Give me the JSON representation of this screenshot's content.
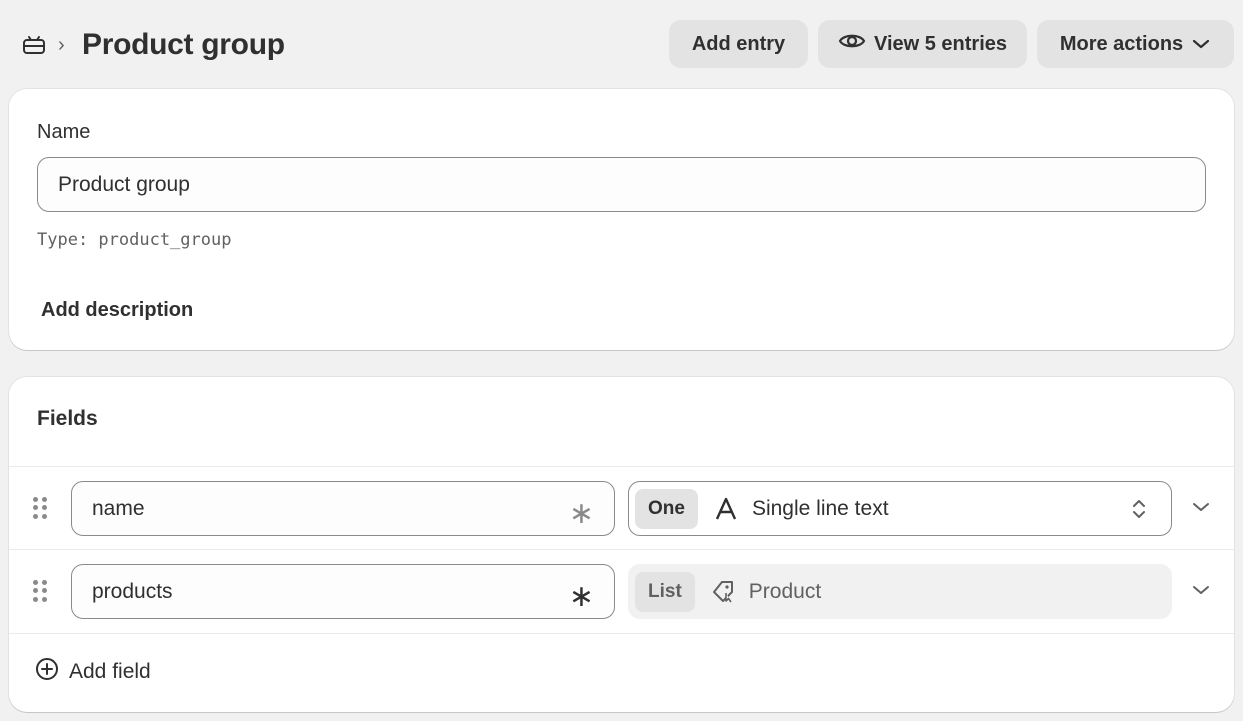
{
  "header": {
    "breadcrumb_separator": "›",
    "title": "Product group",
    "buttons": {
      "add_entry": "Add entry",
      "view_entries": "View 5 entries",
      "more_actions": "More actions"
    }
  },
  "name_card": {
    "label": "Name",
    "value": "Product group",
    "type_line": "Type: product_group",
    "add_description": "Add description"
  },
  "fields_card": {
    "title": "Fields",
    "rows": [
      {
        "key": "name",
        "required_mark": "∗",
        "cardinality": "One",
        "type_icon": "letter-a-icon",
        "type_label": "Single line text",
        "state": "active"
      },
      {
        "key": "products",
        "required_mark": "∗",
        "cardinality": "List",
        "type_icon": "product-tag-icon",
        "type_label": "Product",
        "state": "disabled"
      }
    ],
    "add_field": "Add field"
  },
  "colors": {
    "background": "#f1f1f1",
    "card": "#ffffff",
    "button": "#e3e3e3",
    "text": "#303030",
    "muted_text": "#616161",
    "disabled_text": "#616161"
  }
}
